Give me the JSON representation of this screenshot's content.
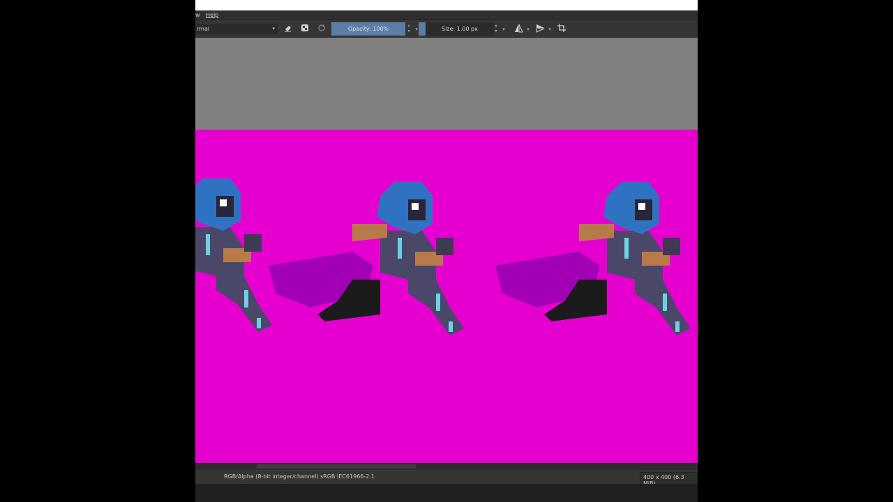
{
  "menubar": {
    "partial_label": "w",
    "help_label": "Help"
  },
  "toolbar": {
    "blend_mode": "rmal",
    "opacity_label": "Opacity: 100%",
    "opacity_value": 1.0,
    "size_label": "Size: 1.00 px",
    "icons": [
      "eraser-icon",
      "alpha-lock-icon",
      "reload-icon",
      "mirror-horizontal-icon",
      "mirror-vertical-icon",
      "crop-icon"
    ]
  },
  "canvas": {
    "background_color": "#e600d0",
    "subject": "pixel-art character run cycle sprites"
  },
  "statusbar": {
    "color_info": "RGB/Alpha (8-bit integer/channel)  sRGB IEC61966-2.1",
    "image_size": "400 x 400 (6.3 MiB)"
  },
  "colors": {
    "accent": "#5a7ea6",
    "canvas_bg": "#e600d0",
    "workspace_gray": "#808080"
  }
}
